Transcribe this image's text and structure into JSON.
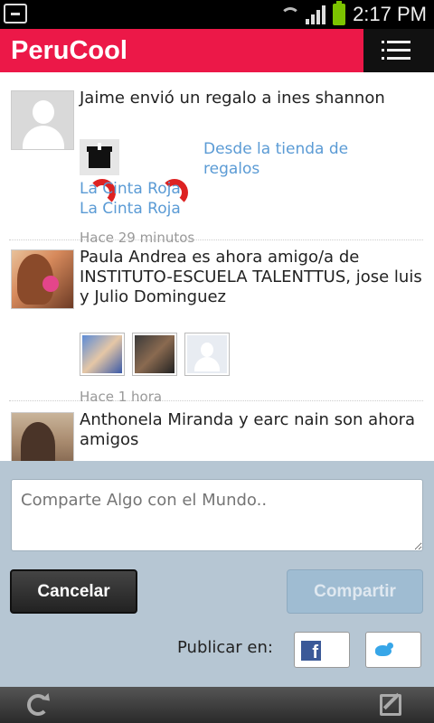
{
  "status_bar": {
    "time": "2:17 PM"
  },
  "app": {
    "title": "PeruCool"
  },
  "feed": [
    {
      "text": "Jaime envió un regalo a ines shannon",
      "store_link": "Desde la tienda de regalos",
      "gift_name": "La Cinta Roja",
      "gift_name_repeat": "La Cinta Roja",
      "time": "Hace 29 minutos",
      "avatar": "default-avatar"
    },
    {
      "text": "Paula Andrea es ahora amigo/a de INSTITUTO-ESCUELA TALENTTUS, jose luis y Julio Dominguez",
      "time": "Hace 1 hora",
      "avatar": "user-photo",
      "thumbs": [
        "friend-photo",
        "friend-photo",
        "default-avatar"
      ]
    },
    {
      "text": "Anthonela Miranda y earc nain son ahora amigos",
      "avatar": "user-photo"
    }
  ],
  "compose": {
    "placeholder": "Comparte Algo con el Mundo..",
    "cancel_label": "Cancelar",
    "share_label": "Compartir",
    "publish_label": "Publicar en:"
  },
  "colors": {
    "brand": "#ec1848",
    "link": "#5b9bd5",
    "compose_bg": "#b6c6d3"
  }
}
